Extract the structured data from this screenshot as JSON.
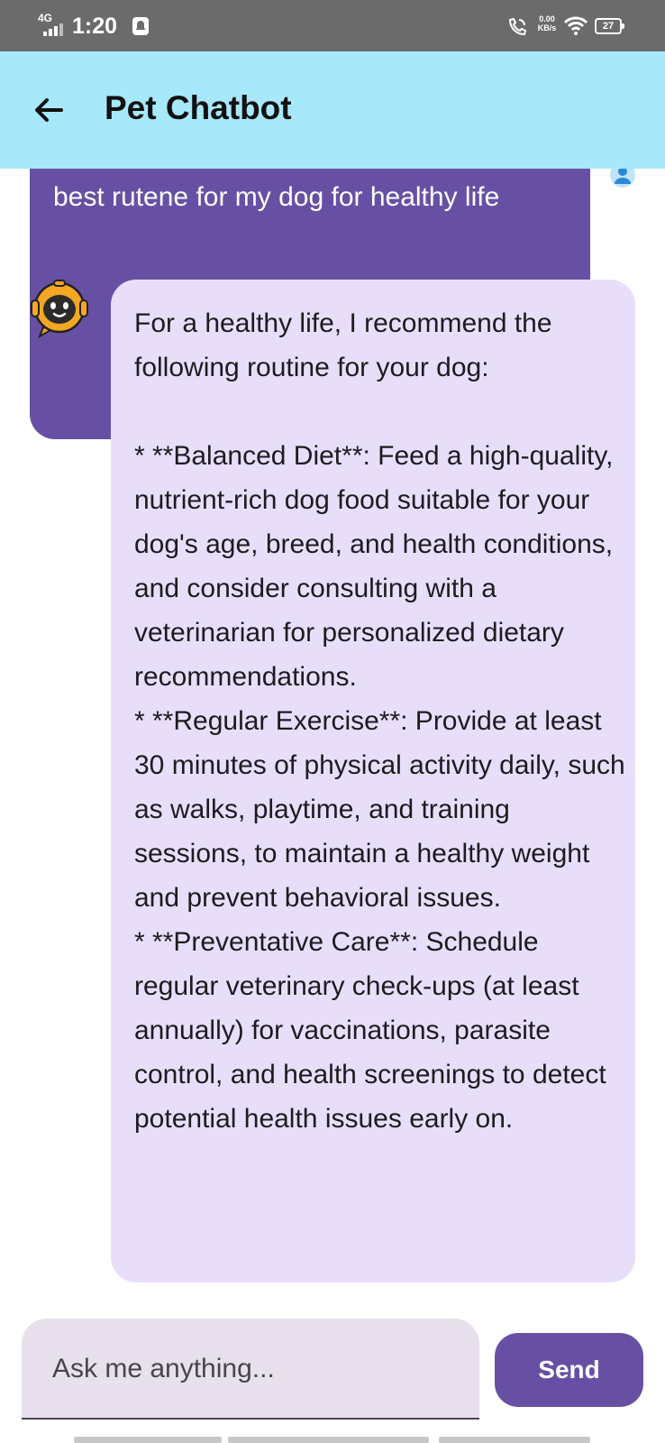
{
  "status_bar": {
    "network": "4G",
    "time": "1:20",
    "speed_value": "0.00",
    "speed_unit": "KB/s",
    "battery": "27"
  },
  "app_bar": {
    "title": "Pet Chatbot",
    "back_icon": "arrow-left-icon"
  },
  "messages": {
    "user_text": "best rutene for my dog for healthy life",
    "bot_text": "For a healthy life, I recommend the following routine for your dog:\n\n* **Balanced Diet**: Feed a high-quality, nutrient-rich dog food suitable for your dog's age, breed, and health conditions, and consider consulting with a veterinarian for personalized dietary recommendations.\n* **Regular Exercise**: Provide at least 30 minutes of physical activity daily, such as walks, playtime, and training sessions, to maintain a healthy weight and prevent behavioral issues.\n* **Preventative Care**: Schedule regular veterinary check-ups (at least annually) for vaccinations, parasite control, and health screenings to detect potential health issues early on."
  },
  "input": {
    "placeholder": "Ask me anything...",
    "value": "",
    "send_label": "Send"
  },
  "colors": {
    "app_bar": "#a7e8fb",
    "primary": "#6750a4",
    "bot_bubble": "#e9defa",
    "input_bg": "#e8e0ec"
  }
}
